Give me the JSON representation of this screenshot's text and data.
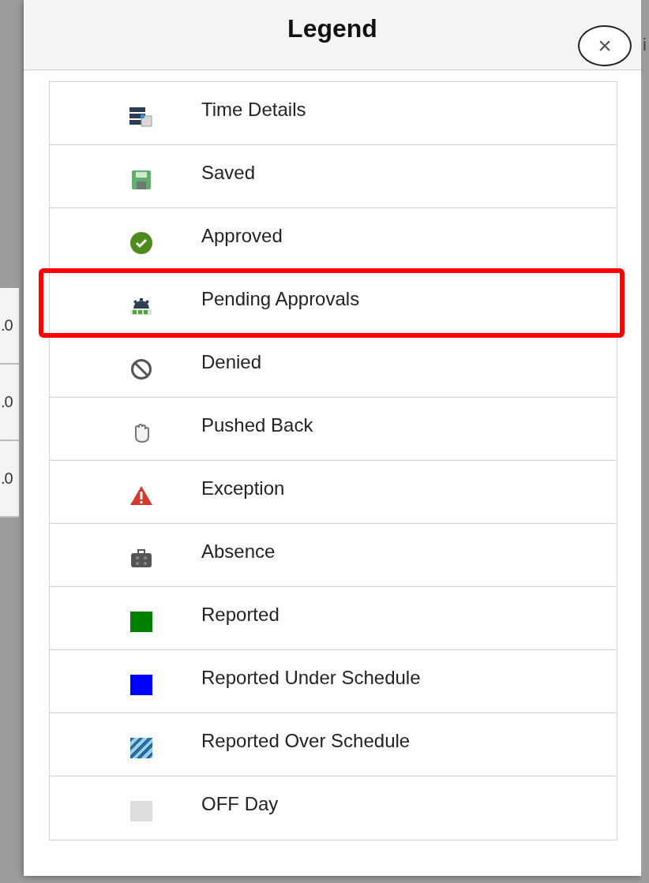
{
  "background_left": [
    ".0",
    ".0",
    ".0"
  ],
  "background_right": [
    "i"
  ],
  "dialog": {
    "title": "Legend",
    "close": "×"
  },
  "items": [
    {
      "kind": "time-details",
      "label": "Time Details",
      "highlighted": false
    },
    {
      "kind": "saved",
      "label": "Saved",
      "highlighted": false
    },
    {
      "kind": "approved",
      "label": "Approved",
      "highlighted": false
    },
    {
      "kind": "pending",
      "label": "Pending Approvals",
      "highlighted": true
    },
    {
      "kind": "denied",
      "label": "Denied",
      "highlighted": false
    },
    {
      "kind": "pushed-back",
      "label": "Pushed Back",
      "highlighted": false
    },
    {
      "kind": "exception",
      "label": "Exception",
      "highlighted": false
    },
    {
      "kind": "absence",
      "label": "Absence",
      "highlighted": false
    },
    {
      "kind": "swatch",
      "color": "#008000",
      "label": "Reported",
      "highlighted": false
    },
    {
      "kind": "swatch",
      "color": "#0000ff",
      "label": "Reported Under Schedule",
      "highlighted": false
    },
    {
      "kind": "striped",
      "label": "Reported Over Schedule",
      "highlighted": false
    },
    {
      "kind": "swatch",
      "color": "#dddddd",
      "label": "OFF Day",
      "highlighted": false
    }
  ]
}
